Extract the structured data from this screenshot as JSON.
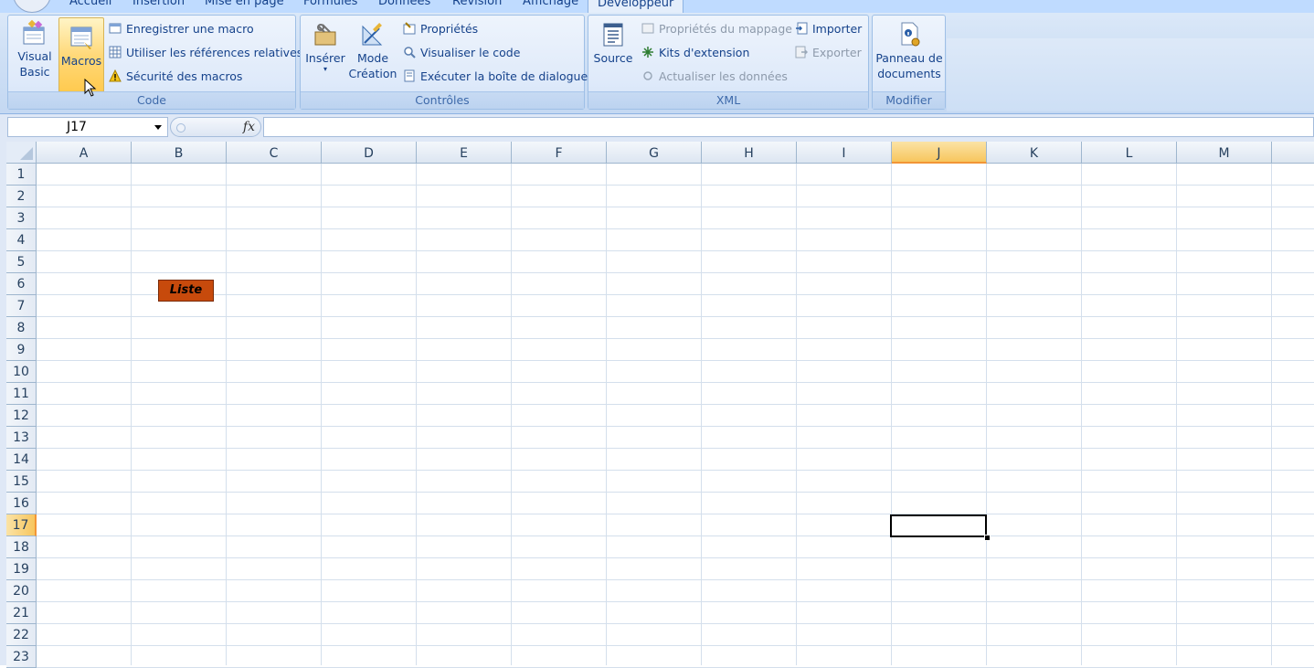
{
  "tabs": {
    "accueil": "Accueil",
    "insertion": "Insertion",
    "mise_en_page": "Mise en page",
    "formules": "Formules",
    "donnees": "Données",
    "revision": "Révision",
    "affichage": "Affichage",
    "developpeur": "Développeur"
  },
  "ribbon": {
    "code": {
      "label": "Code",
      "visual_basic_line1": "Visual",
      "visual_basic_line2": "Basic",
      "macros": "Macros",
      "enregistrer": "Enregistrer une macro",
      "references": "Utiliser les références relatives",
      "securite": "Sécurité des macros"
    },
    "controles": {
      "label": "Contrôles",
      "inserer": "Insérer",
      "mode_line1": "Mode",
      "mode_line2": "Création",
      "proprietes": "Propriétés",
      "visualiser": "Visualiser le code",
      "executer": "Exécuter la boîte de dialogue"
    },
    "xml": {
      "label": "XML",
      "source": "Source",
      "proprietes_mappage": "Propriétés du mappage",
      "kits": "Kits d'extension",
      "actualiser": "Actualiser les données",
      "importer": "Importer",
      "exporter": "Exporter"
    },
    "modifier": {
      "label": "Modifier",
      "panneau_line1": "Panneau de",
      "panneau_line2": "documents"
    }
  },
  "formula_bar": {
    "name_box": "J17",
    "fx": "fx",
    "formula": ""
  },
  "sheet": {
    "columns": [
      "A",
      "B",
      "C",
      "D",
      "E",
      "F",
      "G",
      "H",
      "I",
      "J",
      "K",
      "L",
      "M"
    ],
    "rows": [
      "1",
      "2",
      "3",
      "4",
      "5",
      "6",
      "7",
      "8",
      "9",
      "10",
      "11",
      "12",
      "13",
      "14",
      "15",
      "16",
      "17",
      "18",
      "19",
      "20",
      "21",
      "22",
      "23"
    ],
    "selected_column": "J",
    "selected_row": "17",
    "button_liste": "Liste"
  },
  "colors": {
    "ribbon_blue": "#bfdbff",
    "selection_orange": "#f7c65d",
    "liste_button": "#c74a0c"
  }
}
